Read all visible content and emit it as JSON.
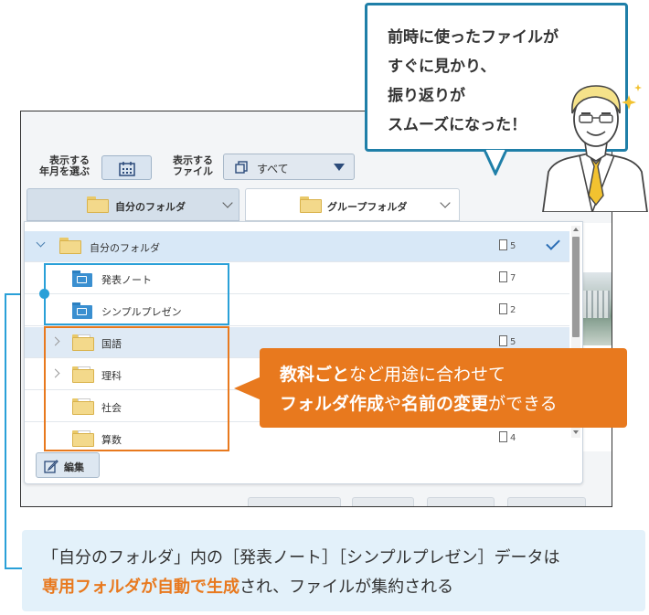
{
  "bubble": {
    "line1": "前時に使ったファイルが",
    "line2": "すぐに見かり、",
    "line3": "振り返りが",
    "line4": "スムーズになった！"
  },
  "toolbar": {
    "date_label_1": "表示する",
    "date_label_2": "年月を選ぶ",
    "type_label_1": "表示する",
    "type_label_2": "ファイル",
    "type_value": "すべて"
  },
  "tabs": {
    "my_folder": "自分のフォルダ",
    "group_folder": "グループフォルダ"
  },
  "tree": {
    "root": {
      "label": "自分のフォルダ",
      "count": "5"
    },
    "items": [
      {
        "label": "発表ノート",
        "count": "7"
      },
      {
        "label": "シンプルプレゼン",
        "count": "2"
      },
      {
        "label": "国語",
        "count": "5"
      },
      {
        "label": "理科",
        "count": ""
      },
      {
        "label": "社会",
        "count": ""
      },
      {
        "label": "算数",
        "count": "4"
      }
    ]
  },
  "edit_button": "編集",
  "orange_callout": {
    "l1_bold": "教科ごと",
    "l1_rest": "など用途に合わせて",
    "l2_bold1": "フォルダ作成",
    "l2_mid": "や",
    "l2_bold2": "名前の変更",
    "l2_rest": "ができる"
  },
  "note": {
    "line1": "「自分のフォルダ」内の［発表ノート］［シンプルプレゼン］データは",
    "line2_em": "専用フォルダが自動で生成",
    "line2_rest": "され、ファイルが集約される"
  },
  "colors": {
    "accent_blue": "#2aa0d8",
    "accent_orange": "#e8791e",
    "bubble_border": "#1f7fa8"
  }
}
